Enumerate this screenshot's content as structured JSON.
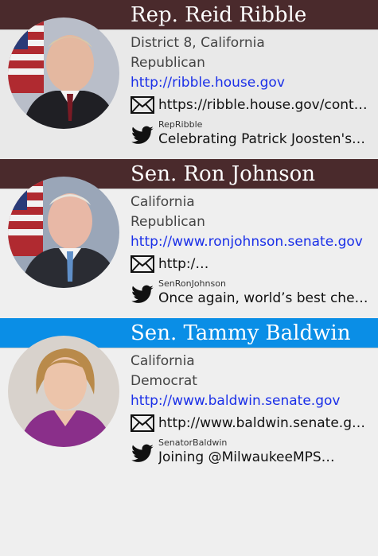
{
  "colors": {
    "header_maroon": "#4a2a2c",
    "header_selected": "#0a8ee6",
    "link": "#1a2fe8"
  },
  "icons": {
    "mail": "mail-icon",
    "twitter": "twitter-bird-icon"
  },
  "reps": [
    {
      "name": "Rep. Reid Ribble",
      "location": "District 8, California",
      "party": "Republican",
      "website": "http://ribble.house.gov",
      "contact": "https://ribble.house.gov/contac…",
      "twitter_handle": "RepRibble",
      "tweet": "Celebrating Patrick Joosten's…",
      "header_color": "#4a2a2c"
    },
    {
      "name": "Sen. Ron Johnson",
      "location": "California",
      "party": "Republican",
      "website": "http://www.ronjohnson.senate.gov",
      "contact": "http:/…",
      "twitter_handle": "SenRonJohnson",
      "tweet": "Once again, world’s best cheese…",
      "header_color": "#4a2a2c"
    },
    {
      "name": "Sen. Tammy Baldwin",
      "location": "California",
      "party": "Democrat",
      "website": "http://www.baldwin.senate.gov",
      "contact": "http://www.baldwin.senate.gov…",
      "twitter_handle": "SenatorBaldwin",
      "tweet": "Joining @MilwaukeeMPS…",
      "header_color": "#0a8ee6"
    }
  ]
}
